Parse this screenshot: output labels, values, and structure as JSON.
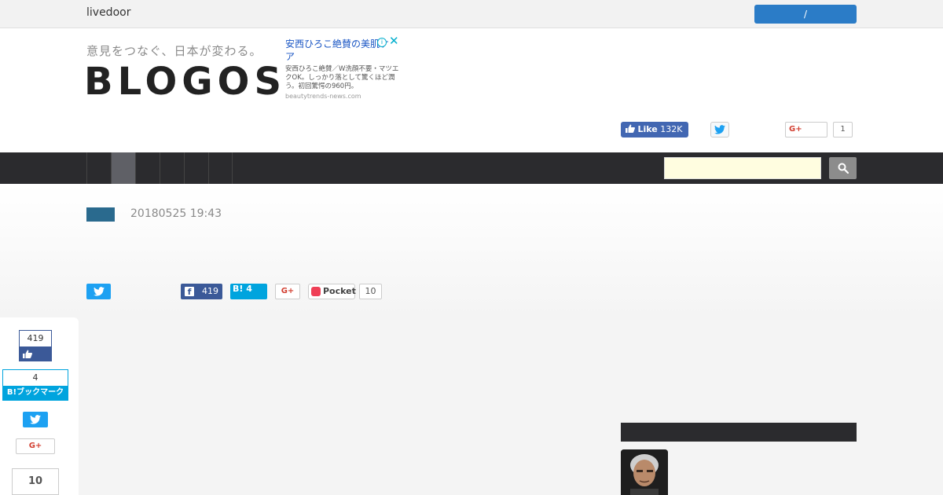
{
  "topbar": {
    "brand": "livedoor",
    "login_label": "/"
  },
  "header": {
    "tagline": "意見をつなぐ、日本が変わる。",
    "logo": "BLOGOS"
  },
  "ad": {
    "title": "安西ひろこ絶賛の美肌ケア",
    "body": "安西ひろこ絶賛／W洗顔不要・マツエクOK。しっかり落として驚くほど潤う。初回驚愕の960円。",
    "domain": "beautytrends-news.com",
    "info_icon": "i",
    "close_icon": "✕"
  },
  "header_social": {
    "fb_like_label": "Like",
    "fb_like_count": "132K",
    "gplus_label": "G+",
    "gplus_count": "1"
  },
  "nav": {
    "items": [
      "",
      "",
      "",
      "",
      "",
      ""
    ],
    "active_index": 1,
    "search_placeholder": ""
  },
  "article": {
    "datetime": "20180525 19:43",
    "share": {
      "fb_count": "419",
      "hatena_label": "B!",
      "hatena_count": "4",
      "gplus_label": "G+",
      "pocket_label": "Pocket",
      "pocket_count": "10"
    }
  },
  "floating_share": {
    "fb_count": "419",
    "hatena_count": "4",
    "hatena_label": "B!ブックマーク",
    "gplus_label": "G+",
    "pocket_count": "10"
  },
  "colors": {
    "nav_bg": "#2b2b2e",
    "accent_blue": "#2b7cc7",
    "facebook": "#3b5998",
    "twitter": "#1da1f2",
    "hatena": "#00a4de",
    "pocket": "#ef3f56"
  }
}
